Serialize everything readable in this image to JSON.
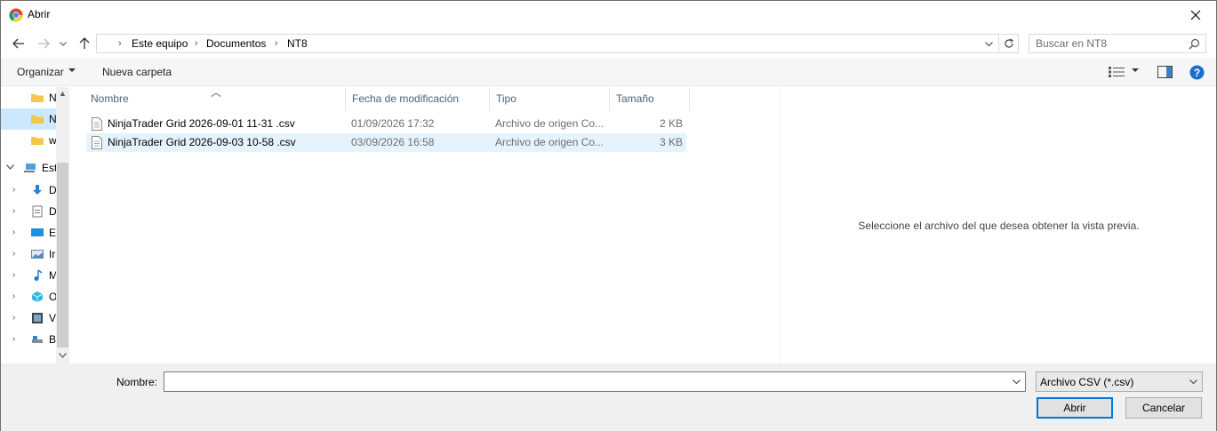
{
  "window": {
    "title": "Abrir"
  },
  "address": {
    "breadcrumbs": [
      "Este equipo",
      "Documentos",
      "NT8"
    ]
  },
  "search": {
    "placeholder": "Buscar en NT8"
  },
  "toolbar": {
    "organize_label": "Organizar",
    "new_folder_label": "Nueva carpeta"
  },
  "nav": {
    "items": [
      {
        "label": "N",
        "icon": "folder-icon",
        "selected": false
      },
      {
        "label": "N",
        "icon": "folder-icon",
        "selected": true
      },
      {
        "label": "w",
        "icon": "folder-icon",
        "selected": false
      },
      {
        "label": "Est",
        "icon": "computer-icon",
        "expanded": true
      },
      {
        "label": "D",
        "icon": "downloads-icon"
      },
      {
        "label": "D",
        "icon": "documents-icon"
      },
      {
        "label": "E",
        "icon": "desktop-icon"
      },
      {
        "label": "Ir",
        "icon": "pictures-icon"
      },
      {
        "label": "M",
        "icon": "music-icon"
      },
      {
        "label": "O",
        "icon": "3d-objects-icon"
      },
      {
        "label": "V",
        "icon": "videos-icon"
      },
      {
        "label": "B",
        "icon": "drive-icon"
      }
    ]
  },
  "columns": {
    "name": "Nombre",
    "date": "Fecha de modificación",
    "type": "Tipo",
    "size": "Tamaño"
  },
  "files": [
    {
      "name": "NinjaTrader Grid 2026-09-01 11-31 .csv",
      "date": "01/09/2026 17:32",
      "type": "Archivo de origen Co...",
      "size": "2 KB",
      "selected": false
    },
    {
      "name": "NinjaTrader Grid 2026-09-03 10-58 .csv",
      "date": "03/09/2026 16:58",
      "type": "Archivo de origen Co...",
      "size": "3 KB",
      "selected": true
    }
  ],
  "preview": {
    "message": "Seleccione el archivo del que desea obtener la vista previa."
  },
  "footer": {
    "name_label": "Nombre:",
    "name_value": "",
    "file_type": "Archivo CSV (*.csv)",
    "open_label": "Abrir",
    "cancel_label": "Cancelar"
  },
  "colors": {
    "accent": "#0078d7",
    "selection": "#cce8ff",
    "row_highlight": "#e5f3ff",
    "help": "#1a6fc9"
  }
}
